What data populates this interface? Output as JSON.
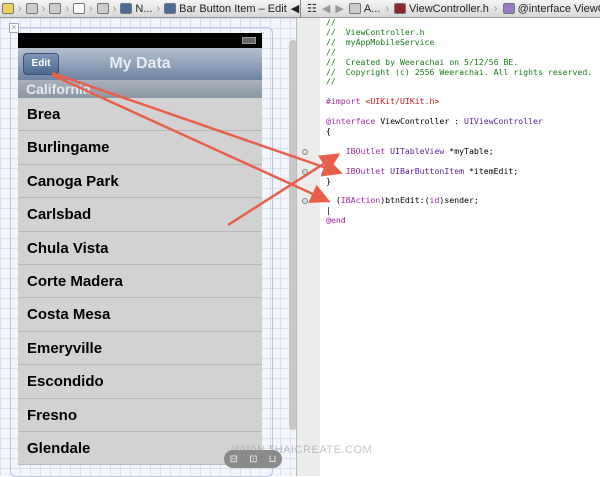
{
  "left_pathbar": {
    "items": [
      "N...",
      "Bar Button Item – Edit"
    ]
  },
  "right_pathbar": {
    "items": [
      "A...",
      "ViewController.h",
      "@interface ViewContro"
    ]
  },
  "simulator": {
    "nav_title": "My Data",
    "edit_button": "Edit",
    "section_header": "California",
    "rows": [
      "Brea",
      "Burlingame",
      "Canoga Park",
      "Carlsbad",
      "Chula Vista",
      "Corte Madera",
      "Costa Mesa",
      "Emeryville",
      "Escondido",
      "Fresno",
      "Glendale"
    ]
  },
  "code": {
    "l1": "//",
    "l2": "//  ViewController.h",
    "l3": "//  myAppMobileService",
    "l4": "//",
    "l5": "//  Created by Weerachai on 5/12/56 BE.",
    "l6": "//  Copyright (c) 2556 Weerachai. All rights reserved.",
    "l7": "//",
    "import_kw": "#import",
    "import_path": "<UIKit/UIKit.h>",
    "interface_kw": "@interface",
    "class_name": "ViewController :",
    "super": "UIViewController",
    "open_brace": "{",
    "iboutlet": "IBOutlet",
    "type1": "UITableView",
    "var1": "*myTable;",
    "type2": "UIBarButtonItem",
    "var2": "*itemEdit;",
    "close_brace": "}",
    "action_prefix": "- (",
    "ibaction": "IBAction",
    "action_mid": ")btnEdit:(",
    "id": "id",
    "action_end": ")sender;",
    "end_kw": "@end"
  },
  "bottom_tools": [
    "⊟",
    "⊡",
    "⊔"
  ],
  "watermark": "WWW.THAICREATE.COM",
  "colors": {
    "arrow": "#e8604c",
    "comment": "#1c7a1c",
    "keyword": "#a22ca0"
  }
}
